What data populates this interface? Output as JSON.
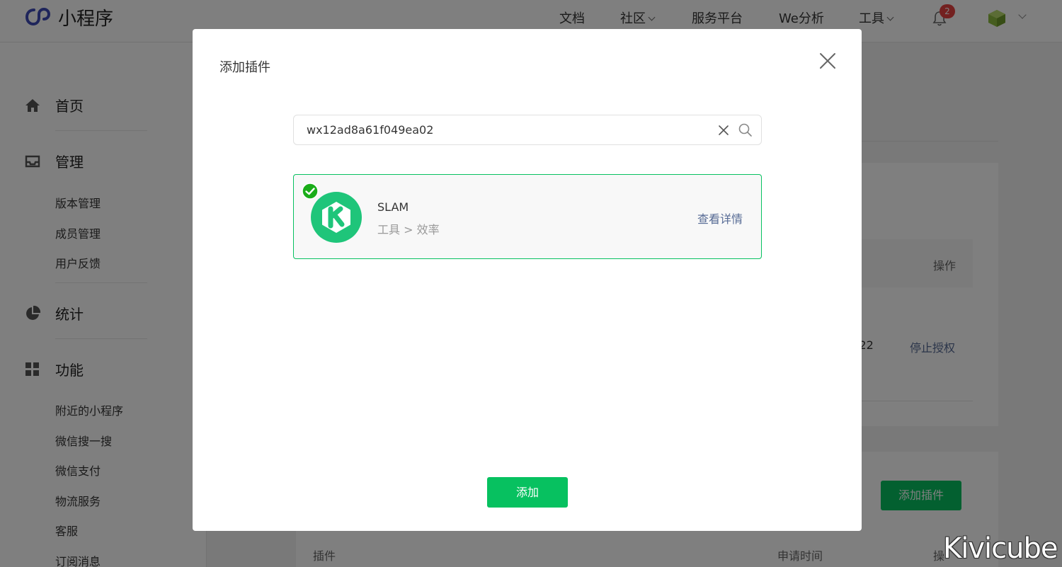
{
  "app": {
    "title": "小程序"
  },
  "nav": {
    "items": [
      {
        "label": "文档"
      },
      {
        "label": "社区"
      },
      {
        "label": "服务平台"
      },
      {
        "label": "We分析"
      },
      {
        "label": "工具"
      }
    ],
    "notification_count": "2"
  },
  "sidebar": {
    "home": "首页",
    "manage": "管理",
    "manage_items": [
      "版本管理",
      "成员管理",
      "用户反馈"
    ],
    "stats": "统计",
    "features": "功能",
    "feature_items": [
      "附近的小程序",
      "微信搜一搜",
      "微信支付",
      "物流服务",
      "客服",
      "订阅消息"
    ]
  },
  "background": {
    "op_header": "操作",
    "time_fragment": ":22",
    "stop_auth": "停止授权",
    "add_plugin": "添加插件",
    "col_plugin": "插件",
    "col_time": "申请时间",
    "col_op": "操"
  },
  "dialog": {
    "title": "添加插件",
    "search_value": "wx12ad8a61f049ea02",
    "result": {
      "name": "SLAM",
      "category": "工具 > 效率",
      "detail_link": "查看详情",
      "selected": true
    },
    "add_button": "添加"
  },
  "watermark": "Kivicube",
  "colors": {
    "accent": "#07c160",
    "link": "#576b95",
    "badge": "#e64340"
  }
}
